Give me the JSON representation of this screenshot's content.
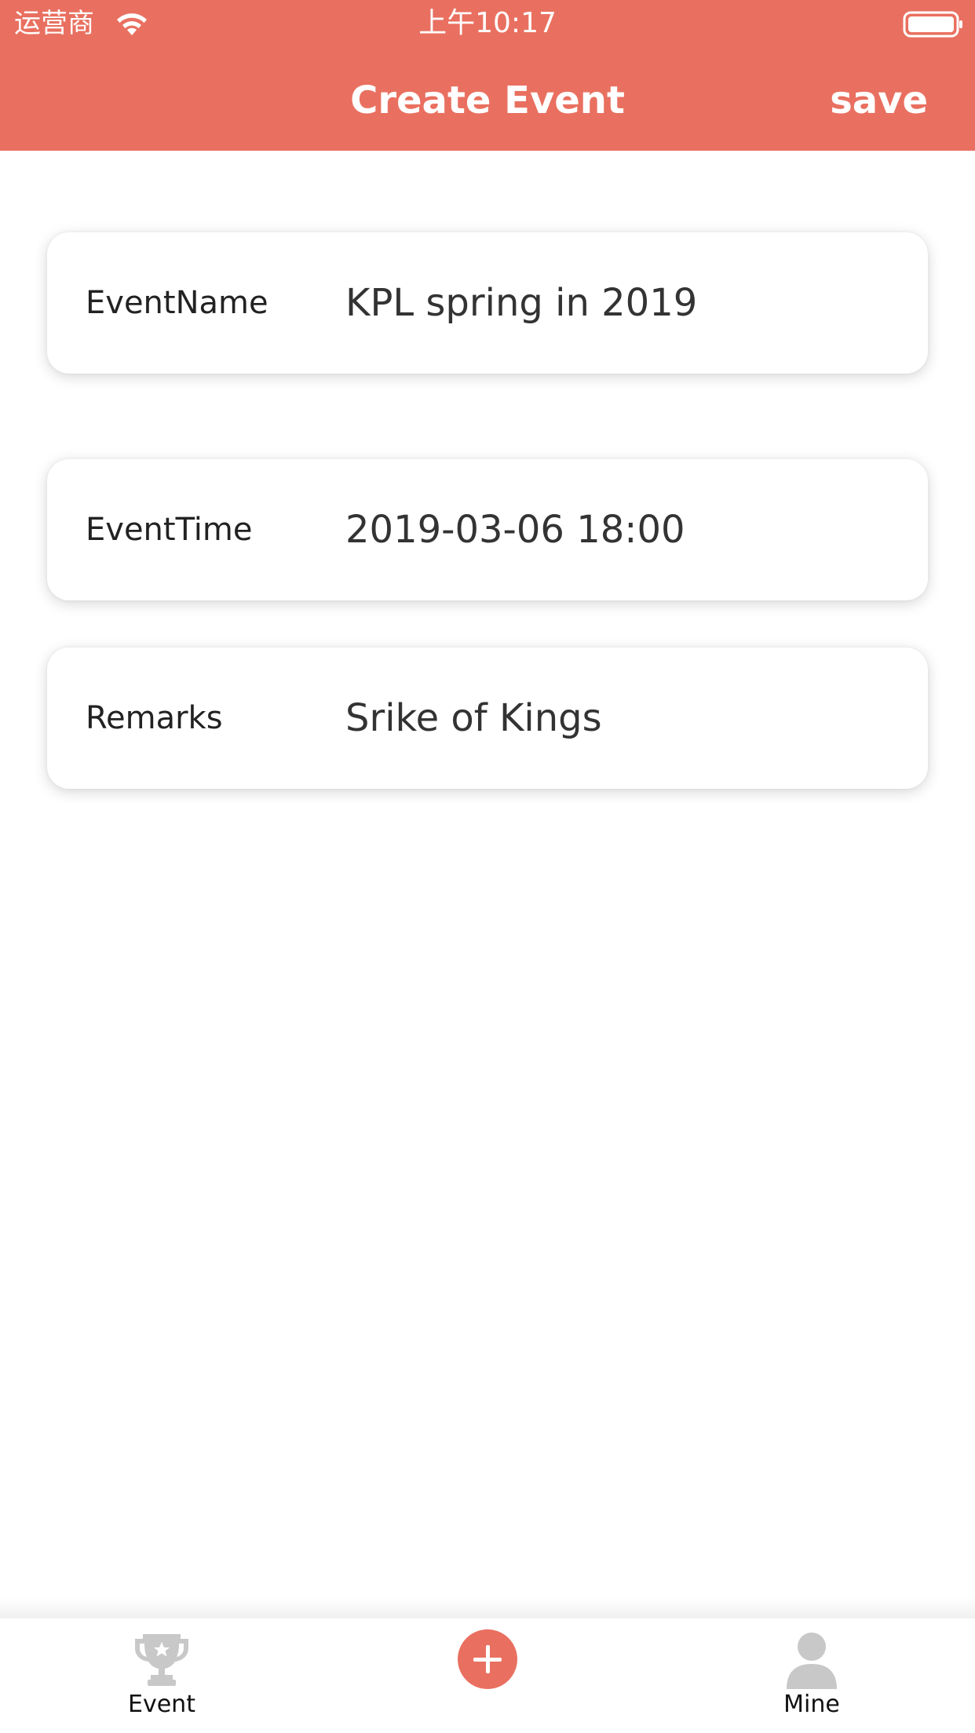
{
  "colors": {
    "accent": "#E97060",
    "background": "#FFFFFF",
    "text": "#222222",
    "tab_icon_inactive": "#C8C8C8"
  },
  "status_bar": {
    "carrier": "运营商",
    "time": "上午10:17",
    "wifi_icon": "wifi-icon",
    "battery_icon": "battery-icon"
  },
  "nav_bar": {
    "title": "Create Event",
    "save_label": "save"
  },
  "form": {
    "fields": [
      {
        "label": "EventName",
        "value": "KPL spring in 2019"
      },
      {
        "label": "EventTime",
        "value": "2019-03-06 18:00"
      },
      {
        "label": "Remarks",
        "value": "Srike of Kings"
      }
    ]
  },
  "tab_bar": {
    "tabs": [
      {
        "label": "Event",
        "icon": "trophy-icon"
      },
      {
        "label": "",
        "icon": "add-circle-icon"
      },
      {
        "label": "Mine",
        "icon": "person-icon"
      }
    ]
  }
}
